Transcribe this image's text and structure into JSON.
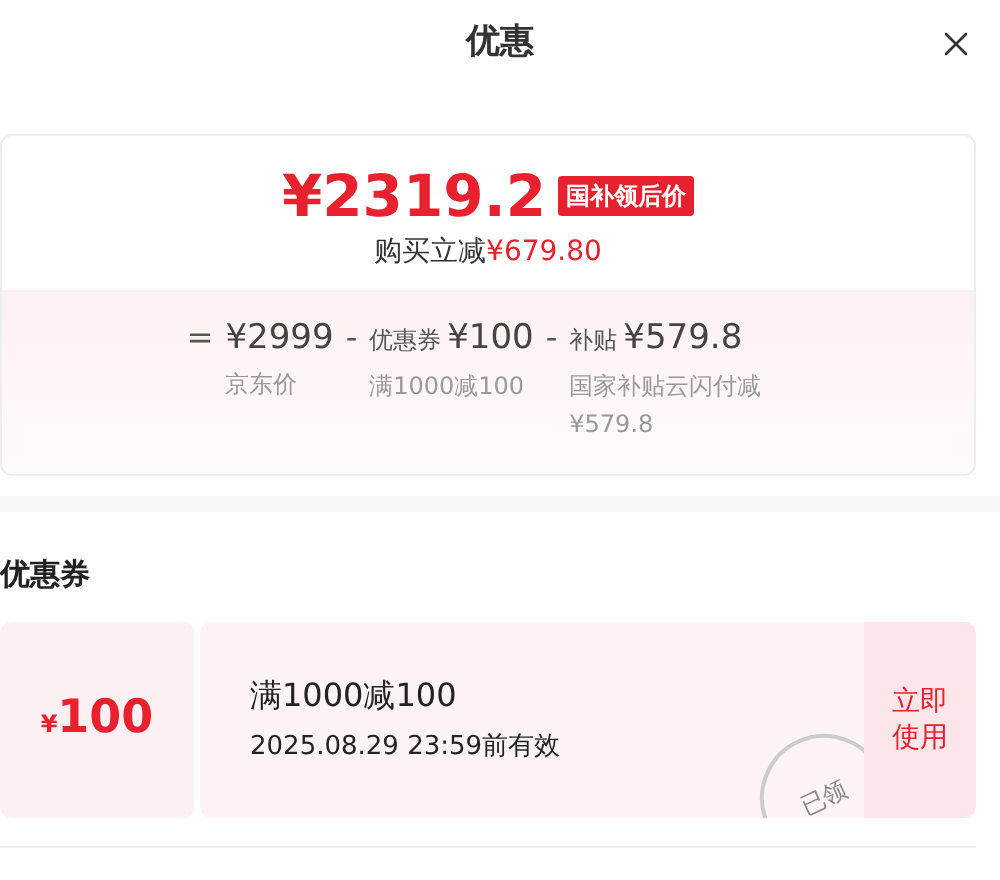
{
  "header": {
    "title": "优惠"
  },
  "price": {
    "final": "¥2319.2",
    "badge": "国补领后价",
    "saving_label": "购买立减",
    "saving_amount": "¥679.80",
    "breakdown": [
      {
        "op": "=",
        "amount": "¥2999",
        "note": "京东价"
      },
      {
        "op": "-",
        "label": "优惠券",
        "amount": "¥100",
        "note": "满1000减100"
      },
      {
        "op": "-",
        "label": "补贴",
        "amount": "¥579.8",
        "note": "国家补贴云闪付减¥579.8"
      }
    ]
  },
  "coupons_section": {
    "title": "优惠券",
    "coupons": [
      {
        "currency": "¥",
        "value": "100",
        "condition": "满1000减100",
        "validity": "2025.08.29 23:59前有效",
        "claimed": true,
        "stamp": "已领",
        "action": "立即使用"
      }
    ]
  }
}
